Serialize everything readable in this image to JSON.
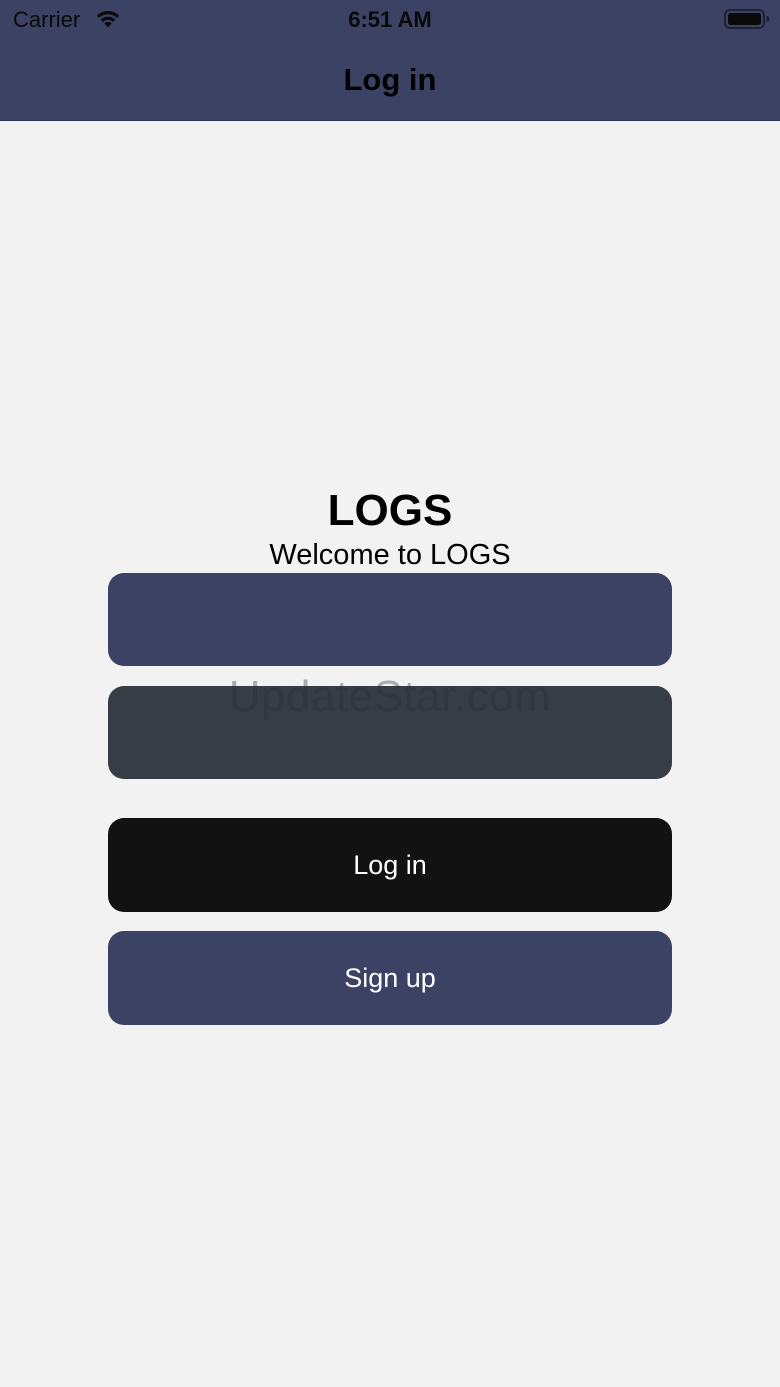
{
  "status_bar": {
    "carrier": "Carrier",
    "time": "6:51 AM",
    "wifi_icon": "wifi-icon",
    "battery_icon": "battery-icon"
  },
  "nav": {
    "title": "Log in"
  },
  "main": {
    "app_title": "LOGS",
    "subtitle": "Welcome to LOGS",
    "username": {
      "value": "",
      "placeholder": ""
    },
    "password": {
      "value": "",
      "placeholder": ""
    },
    "login_label": "Log in",
    "signup_label": "Sign up"
  },
  "watermark": "UpdateStar.com",
  "colors": {
    "header": "#3b4264",
    "background": "#f2f2f2",
    "username_field": "#3b4264",
    "password_field": "#363d45",
    "login_button": "#121212",
    "signup_button": "#3b4264"
  }
}
